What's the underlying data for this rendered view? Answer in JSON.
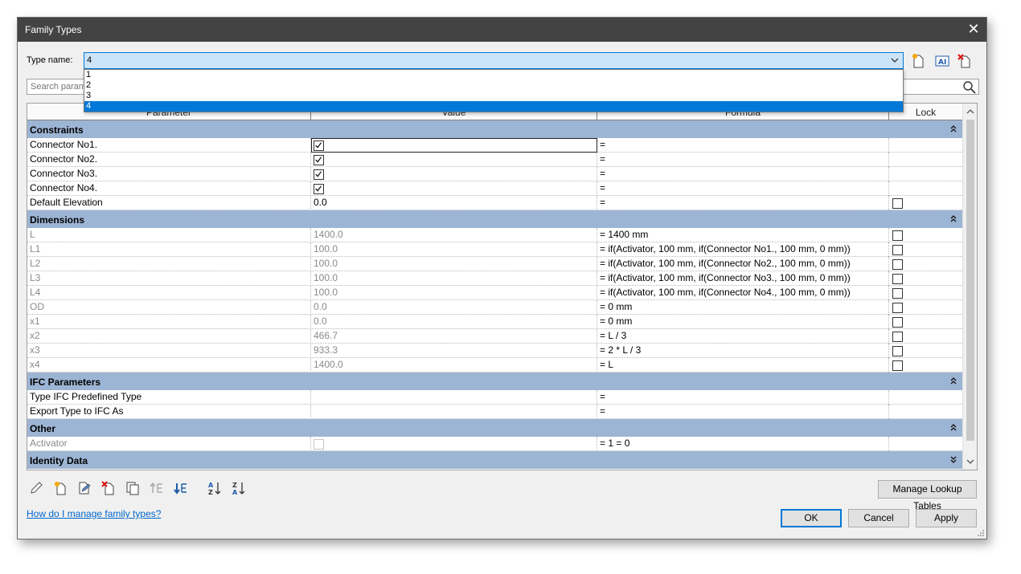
{
  "window": {
    "title": "Family Types"
  },
  "type_name": {
    "label": "Type name:",
    "value": "4",
    "options": [
      "1",
      "2",
      "3",
      "4"
    ],
    "selected_index": 3
  },
  "search": {
    "placeholder": "Search parameters"
  },
  "table": {
    "headers": {
      "parameter": "Parameter",
      "value": "Value",
      "formula": "Formula",
      "lock": "Lock"
    },
    "groups": [
      {
        "name": "Constraints",
        "expanded": true,
        "rows": [
          {
            "name": "Connector No1.",
            "value_type": "checkbox",
            "checked": true,
            "formula": "=",
            "lock": null,
            "dim": false,
            "focus": true
          },
          {
            "name": "Connector No2.",
            "value_type": "checkbox",
            "checked": true,
            "formula": "=",
            "lock": null,
            "dim": false
          },
          {
            "name": "Connector No3.",
            "value_type": "checkbox",
            "checked": true,
            "formula": "=",
            "lock": null,
            "dim": false
          },
          {
            "name": "Connector No4.",
            "value_type": "checkbox",
            "checked": true,
            "formula": "=",
            "lock": null,
            "dim": false
          },
          {
            "name": "Default Elevation",
            "value_type": "text",
            "value": "0.0",
            "formula": "=",
            "lock": false,
            "dim": false
          }
        ]
      },
      {
        "name": "Dimensions",
        "expanded": true,
        "rows": [
          {
            "name": "L",
            "value_type": "text",
            "value": "1400.0",
            "formula": "= 1400 mm",
            "lock": false,
            "dim": true
          },
          {
            "name": "L1",
            "value_type": "text",
            "value": "100.0",
            "formula": "= if(Activator, 100 mm, if(Connector No1., 100 mm, 0 mm))",
            "lock": false,
            "dim": true
          },
          {
            "name": "L2",
            "value_type": "text",
            "value": "100.0",
            "formula": "= if(Activator, 100 mm, if(Connector No2., 100 mm, 0 mm))",
            "lock": false,
            "dim": true
          },
          {
            "name": "L3",
            "value_type": "text",
            "value": "100.0",
            "formula": "= if(Activator, 100 mm, if(Connector No3., 100 mm, 0 mm))",
            "lock": false,
            "dim": true
          },
          {
            "name": "L4",
            "value_type": "text",
            "value": "100.0",
            "formula": "= if(Activator, 100 mm, if(Connector No4., 100 mm, 0 mm))",
            "lock": false,
            "dim": true
          },
          {
            "name": "OD",
            "value_type": "text",
            "value": "0.0",
            "formula": "= 0 mm",
            "lock": false,
            "dim": true
          },
          {
            "name": "x1",
            "value_type": "text",
            "value": "0.0",
            "formula": "= 0 mm",
            "lock": false,
            "dim": true
          },
          {
            "name": "x2",
            "value_type": "text",
            "value": "466.7",
            "formula": "= L / 3",
            "lock": false,
            "dim": true
          },
          {
            "name": "x3",
            "value_type": "text",
            "value": "933.3",
            "formula": "= 2 * L / 3",
            "lock": false,
            "dim": true
          },
          {
            "name": "x4",
            "value_type": "text",
            "value": "1400.0",
            "formula": "= L",
            "lock": false,
            "dim": true
          }
        ]
      },
      {
        "name": "IFC Parameters",
        "expanded": true,
        "rows": [
          {
            "name": "Type IFC Predefined Type",
            "value_type": "text",
            "value": "",
            "formula": "=",
            "lock": null,
            "dim": false
          },
          {
            "name": "Export Type to IFC As",
            "value_type": "text",
            "value": "",
            "formula": "=",
            "lock": null,
            "dim": false
          }
        ]
      },
      {
        "name": "Other",
        "expanded": true,
        "rows": [
          {
            "name": "Activator",
            "value_type": "checkbox",
            "checked": false,
            "faint": true,
            "formula": "= 1 = 0",
            "lock": null,
            "dim": true
          }
        ]
      },
      {
        "name": "Identity Data",
        "expanded": false,
        "rows": []
      }
    ]
  },
  "toolbar_icons": [
    "pencil-icon",
    "new-parameter-icon",
    "edit-parameter-icon",
    "delete-parameter-icon",
    "copy-icon",
    "move-up-icon",
    "move-down-icon",
    "sort-ascending-icon",
    "sort-descending-icon"
  ],
  "buttons": {
    "manage_lookup": "Manage Lookup Tables",
    "ok": "OK",
    "cancel": "Cancel",
    "apply": "Apply"
  },
  "help_link": "How do I manage family types?",
  "colors": {
    "group_header": "#9db5d4",
    "accent": "#0078d7",
    "titlebar": "#434343"
  }
}
